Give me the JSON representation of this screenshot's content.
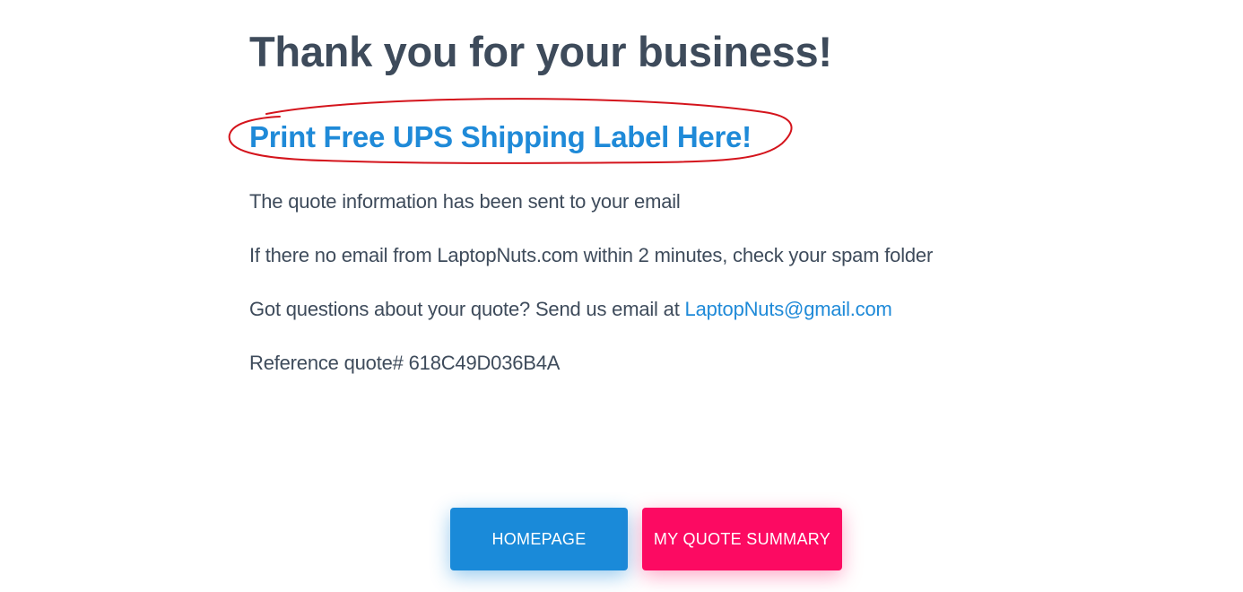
{
  "heading": "Thank you for your business!",
  "print_label_link": "Print Free UPS Shipping Label Here!",
  "messages": {
    "sent": "The quote information has been sent to your email",
    "spam": "If there no email from LaptopNuts.com within 2 minutes, check your spam folder",
    "questions_prefix": "Got questions about your quote? Send us email at ",
    "email": "LaptopNuts@gmail.com",
    "reference_prefix": "Reference quote# ",
    "reference_id": "618C49D036B4A"
  },
  "buttons": {
    "homepage": "HOMEPAGE",
    "quote_summary": "MY QUOTE SUMMARY"
  },
  "colors": {
    "text": "#3e4b5b",
    "link": "#1f8ad8",
    "homepage_button": "#1a8ad9",
    "quote_button": "#fc0a62",
    "annotation": "#d4141c"
  }
}
